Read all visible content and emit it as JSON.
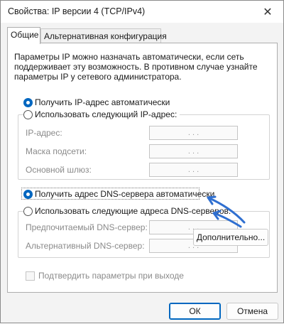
{
  "window": {
    "title": "Свойства: IP версии 4 (TCP/IPv4)",
    "close_glyph": "✕"
  },
  "tabs": [
    {
      "label": "Общие",
      "active": true
    },
    {
      "label": "Альтернативная конфигурация",
      "active": false
    }
  ],
  "intro_text": "Параметры IP можно назначать автоматически, если сеть поддерживает эту возможность. В противном случае узнайте параметры IP у сетевого администратора.",
  "ip_section": {
    "auto_label": "Получить IP-адрес автоматически",
    "manual_label": "Использовать следующий IP-адрес:",
    "fields": [
      {
        "label": "IP-адрес:",
        "value": ".   .   ."
      },
      {
        "label": "Маска подсети:",
        "value": ".   .   ."
      },
      {
        "label": "Основной шлюз:",
        "value": ".   .   ."
      }
    ]
  },
  "dns_section": {
    "auto_label": "Получить адрес DNS-сервера автоматически",
    "manual_label": "Использовать следующие адреса DNS-серверов:",
    "fields": [
      {
        "label": "Предпочитаемый DNS-сервер:",
        "value": ".   .   ."
      },
      {
        "label": "Альтернативный DNS-сервер:",
        "value": ".   .   ."
      }
    ]
  },
  "validate_label": "Подтвердить параметры при выходе",
  "buttons": {
    "advanced": "Дополнительно...",
    "ok": "ОК",
    "cancel": "Отмена"
  },
  "colors": {
    "accent": "#0067c0",
    "annotation_arrow": "#2f6fd0"
  }
}
